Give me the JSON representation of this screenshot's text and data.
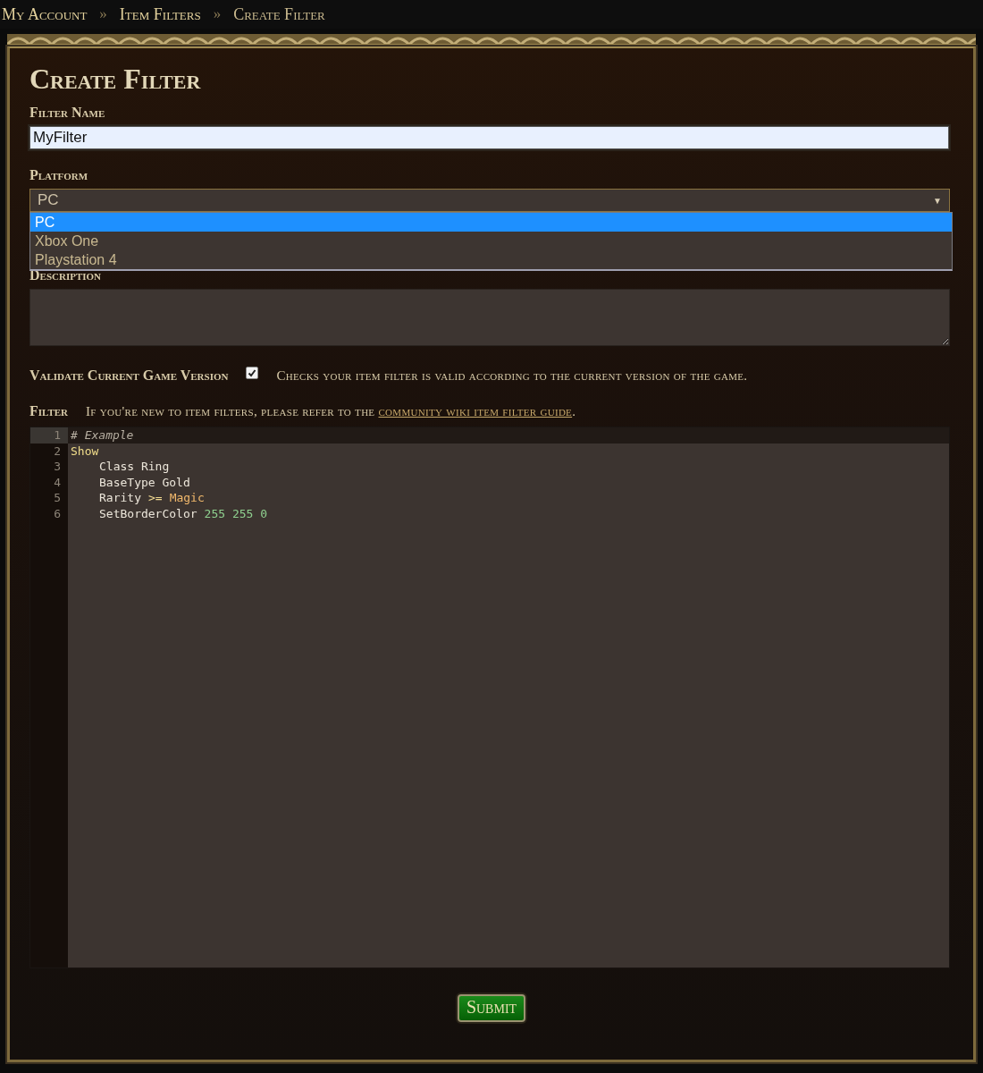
{
  "breadcrumb": [
    {
      "label": "My Account",
      "current": false
    },
    {
      "label": "Item Filters",
      "current": false
    },
    {
      "label": "Create Filter",
      "current": true
    }
  ],
  "breadcrumb_separator": "»",
  "title": "Create Filter",
  "filter_name": {
    "label": "Filter Name",
    "value": "MyFilter"
  },
  "platform": {
    "label": "Platform",
    "value": "PC",
    "arrow": "▼",
    "expanded": true,
    "options": [
      {
        "label": "PC",
        "selected": true
      },
      {
        "label": "Xbox One",
        "selected": false
      },
      {
        "label": "Playstation 4",
        "selected": false
      }
    ]
  },
  "description": {
    "label": "Description"
  },
  "validate": {
    "label": "Validate Current Game Version",
    "checked": true,
    "hint": "Checks your item filter is valid according to the current version of the game."
  },
  "filter": {
    "label": "Filter",
    "hint_before": "If you're new to item filters, please refer to the",
    "link": "community wiki item filter guide",
    "hint_after": ".",
    "lines": [
      {
        "number": "1",
        "active": true,
        "indent": false,
        "tokens": [
          {
            "text": "# Example",
            "kind": "comment"
          }
        ]
      },
      {
        "number": "2",
        "active": false,
        "indent": false,
        "tokens": [
          {
            "text": "Show",
            "kind": "keyword"
          }
        ]
      },
      {
        "number": "3",
        "active": false,
        "indent": true,
        "tokens": [
          {
            "text": "Class Ring",
            "kind": "plain"
          }
        ]
      },
      {
        "number": "4",
        "active": false,
        "indent": true,
        "tokens": [
          {
            "text": "BaseType Gold",
            "kind": "plain"
          }
        ]
      },
      {
        "number": "5",
        "active": false,
        "indent": true,
        "tokens": [
          {
            "text": "Rarity",
            "kind": "plain"
          },
          {
            "text": ">=",
            "kind": "operator"
          },
          {
            "text": "Magic",
            "kind": "value"
          }
        ]
      },
      {
        "number": "6",
        "active": false,
        "indent": true,
        "tokens": [
          {
            "text": "SetBorderColor",
            "kind": "plain"
          },
          {
            "text": "255 255 0",
            "kind": "number"
          }
        ]
      }
    ]
  },
  "submit": "Submit"
}
